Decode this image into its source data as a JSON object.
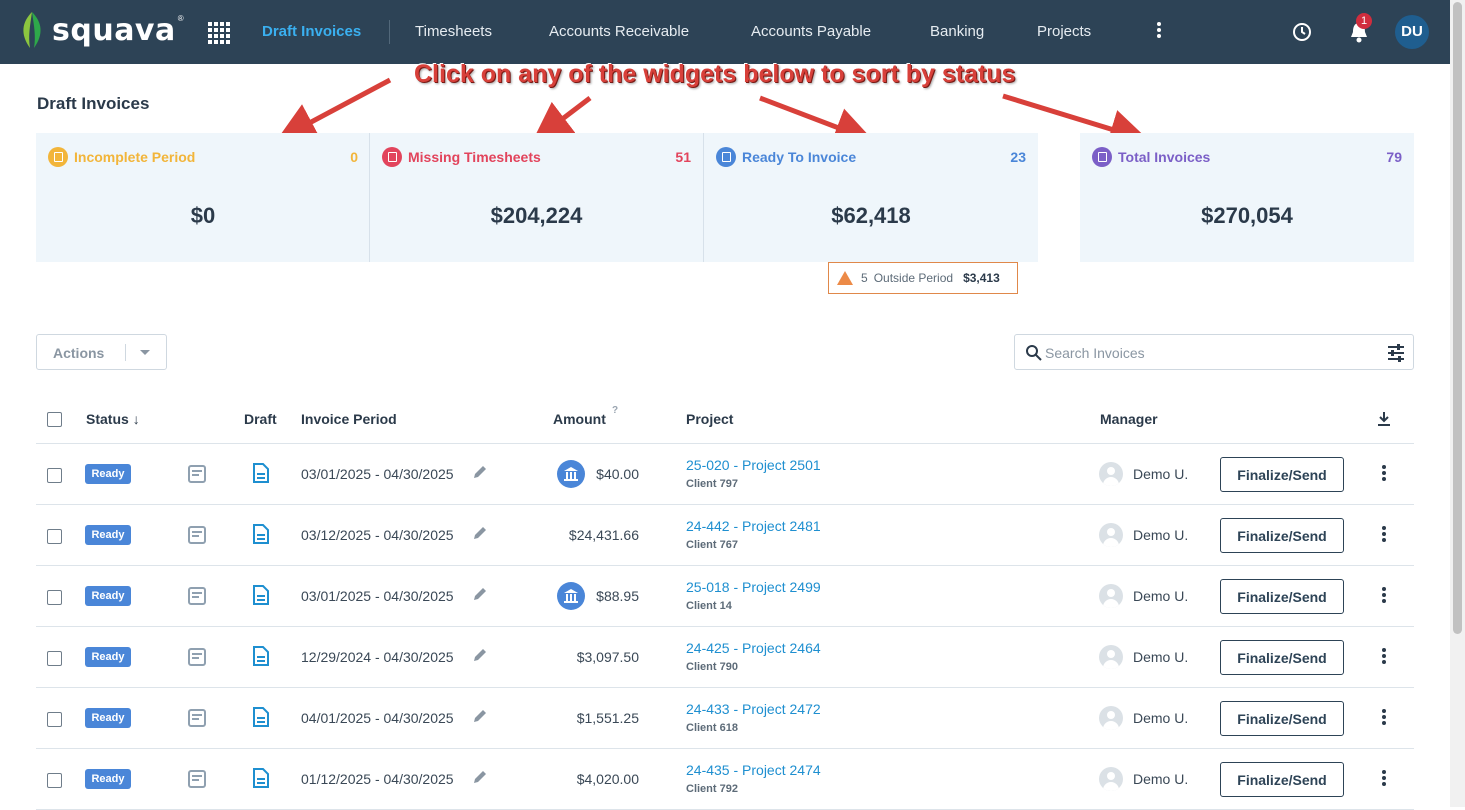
{
  "app": {
    "name": "squava",
    "tm": "®"
  },
  "nav": {
    "items": [
      {
        "label": "Draft Invoices",
        "active": true
      },
      {
        "label": "Timesheets"
      },
      {
        "label": "Accounts Receivable"
      },
      {
        "label": "Accounts Payable"
      },
      {
        "label": "Banking"
      },
      {
        "label": "Projects"
      }
    ],
    "notification_count": "1",
    "user_initials": "DU"
  },
  "page": {
    "title": "Draft Invoices"
  },
  "annotation": "Click on any of the widgets below to sort by status",
  "widgets": [
    {
      "label": "Incomplete Period",
      "count": "0",
      "amount": "$0",
      "color": "#f2b53a"
    },
    {
      "label": "Missing Timesheets",
      "count": "51",
      "amount": "$204,224",
      "color": "#e2445c"
    },
    {
      "label": "Ready To Invoice",
      "count": "23",
      "amount": "$62,418",
      "color": "#4a86d8"
    },
    {
      "label": "Total Invoices",
      "count": "79",
      "amount": "$270,054",
      "color": "#7b5fc7"
    }
  ],
  "outside_period": {
    "count": "5",
    "label": "Outside Period",
    "amount": "$3,413"
  },
  "actions": {
    "label": "Actions"
  },
  "search": {
    "placeholder": "Search Invoices",
    "value": ""
  },
  "table": {
    "headers": {
      "status": "Status",
      "draft": "Draft",
      "period": "Invoice Period",
      "amount": "Amount",
      "amount_help": "?",
      "project": "Project",
      "manager": "Manager"
    },
    "rows": [
      {
        "status": "Ready",
        "period": "03/01/2025 - 04/30/2025",
        "bank": true,
        "amount": "$40.00",
        "project": "25-020 - Project 2501",
        "client": "Client 797",
        "manager": "Demo U.",
        "action": "Finalize/Send"
      },
      {
        "status": "Ready",
        "period": "03/12/2025 - 04/30/2025",
        "bank": false,
        "amount": "$24,431.66",
        "project": "24-442 - Project 2481",
        "client": "Client 767",
        "manager": "Demo U.",
        "action": "Finalize/Send"
      },
      {
        "status": "Ready",
        "period": "03/01/2025 - 04/30/2025",
        "bank": true,
        "amount": "$88.95",
        "project": "25-018 - Project 2499",
        "client": "Client 14",
        "manager": "Demo U.",
        "action": "Finalize/Send"
      },
      {
        "status": "Ready",
        "period": "12/29/2024 - 04/30/2025",
        "bank": false,
        "amount": "$3,097.50",
        "project": "24-425 - Project 2464",
        "client": "Client 790",
        "manager": "Demo U.",
        "action": "Finalize/Send"
      },
      {
        "status": "Ready",
        "period": "04/01/2025 - 04/30/2025",
        "bank": false,
        "amount": "$1,551.25",
        "project": "24-433 - Project 2472",
        "client": "Client 618",
        "manager": "Demo U.",
        "action": "Finalize/Send"
      },
      {
        "status": "Ready",
        "period": "01/12/2025 - 04/30/2025",
        "bank": false,
        "amount": "$4,020.00",
        "project": "24-435 - Project 2474",
        "client": "Client 792",
        "manager": "Demo U.",
        "action": "Finalize/Send"
      }
    ]
  }
}
